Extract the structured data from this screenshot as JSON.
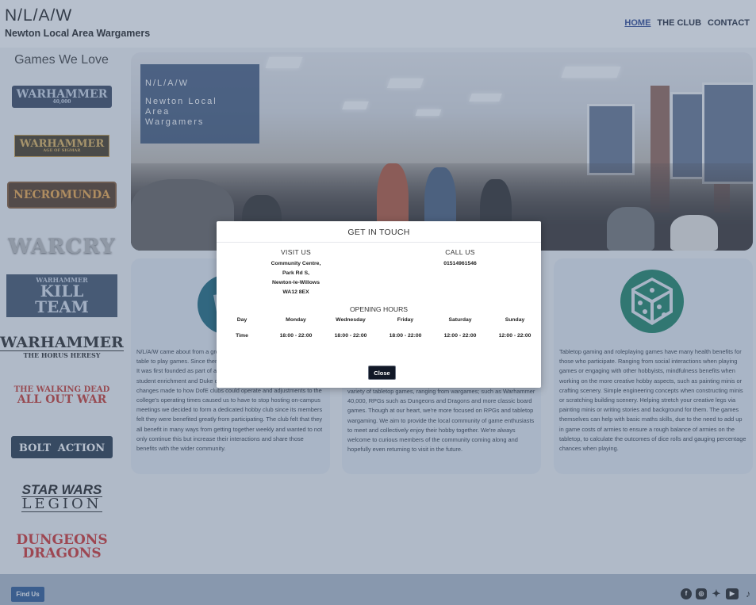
{
  "header": {
    "brand_mark": "N/L/A/W",
    "brand_name": "Newton Local Area Wargamers",
    "nav": [
      {
        "label": "HOME"
      },
      {
        "label": "THE CLUB"
      },
      {
        "label": "CONTACT"
      }
    ]
  },
  "sidebar": {
    "title": "Games We Love",
    "logos": [
      {
        "line1": "WARHAMMER",
        "line2": "40,000",
        "color": "#b9c3d6"
      },
      {
        "line1": "WARHAMMER",
        "line2": "AGE OF SIGMAR",
        "color": "#c9973a"
      },
      {
        "line1": "NECROMUNDA",
        "line2": "",
        "color": "#d08a2c"
      },
      {
        "line1": "WARCRY",
        "line2": "",
        "color": "#c4c4c4"
      },
      {
        "line1": "WARHAMMER",
        "line2": "KILL TEAM",
        "color": "#a9b5c8"
      },
      {
        "line1": "WARHAMMER",
        "line2": "THE HORUS HERESY",
        "color": "#1b1b1b"
      },
      {
        "line1": "THE WALKING DEAD",
        "line2": "ALL OUT WAR",
        "color": "#b5241d"
      },
      {
        "line1": "BOLT",
        "line2": "ACTION",
        "color": "#1f3a5a"
      },
      {
        "line1": "STAR WARS",
        "line2": "LEGION",
        "color": "#111111"
      },
      {
        "line1": "DUNGEONS",
        "line2": "DRAGONS",
        "color": "#c6201f"
      }
    ]
  },
  "hero": {
    "overlay_mark": "N/L/A/W",
    "overlay_line1": "Newton Local",
    "overlay_line2": "Area",
    "overlay_line3": "Wargamers"
  },
  "cards": [
    {
      "text": "N/L/A/W came about from a group of friends who would gather around a table to play games. Since then the club has grown with many benefits. It was first founded as part of a local college's efforts to expand its student enrichment and Duke of Edinburgh curriculum, however after changes made to how DofE clubs could operate and adjustments to the college's operating times caused us to have to stop hosting on-campus meetings we decided to form a dedicated hobby club since its members felt they were benefited greatly from participating. The club felt that they all benefit in many ways from getting together weekly and wanted to not only continue this but increase their interactions and share those benefits with the wider community."
    },
    {
      "text": "variety of tabletop games, ranging from wargames; such as Warhammer 40,000, RPGs such as Dungeons and Dragons and more classic board games. Though at our heart, we're more focused on RPGs and tabletop wargaming. We aim to provide the local community of game enthusiasts to meet and collectively enjoy their hobby together. We're always welcome to curious members of the community coming along and hopefully even returning to visit in the future."
    },
    {
      "text": "Tabletop gaming and roleplaying games have many health benefits for those who participate. Ranging from social interactions when playing games or engaging with other hobbyists, mindfulness benefits when working on the more creative hobby aspects, such as painting minis or crafting scenery. Simple engineering concepts when constructing minis or scratching building scenery. Helping stretch your creative legs via painting minis or writing stories and background for them. The games themselves can help with basic maths skills, due to the need to add up in game costs of armies to ensure a rough balance of armies on the tabletop, to calculate the outcomes of dice rolls and gauging percentage chances when playing."
    }
  ],
  "footer": {
    "find_us": "Find Us",
    "social_icons": [
      "facebook-icon",
      "instagram-icon",
      "twitter-icon",
      "youtube-icon",
      "tiktok-icon"
    ]
  },
  "modal": {
    "title": "GET IN TOUCH",
    "visit_heading": "VISIT US",
    "address": [
      "Community Centre,",
      "Park Rd S,",
      "Newton-le-Willows",
      "WA12 8EX"
    ],
    "call_heading": "CALL US",
    "phone": "01514961546",
    "hours_heading": "OPENING HOURS",
    "hours_labels": [
      "Day",
      "Time"
    ],
    "days": [
      "Monday",
      "Wednesday",
      "Friday",
      "Saturday",
      "Sunday"
    ],
    "times": [
      "18:00 - 22:00",
      "18:00 - 22:00",
      "18:00 - 22:00",
      "12:00 - 22:00",
      "12:00 - 22:00"
    ],
    "close_label": "Close"
  },
  "colors": {
    "primary": "#1e4d8c",
    "overlay": "#1e3a64",
    "close_button": "#111827",
    "dice_icon": "#0b7a5a"
  }
}
